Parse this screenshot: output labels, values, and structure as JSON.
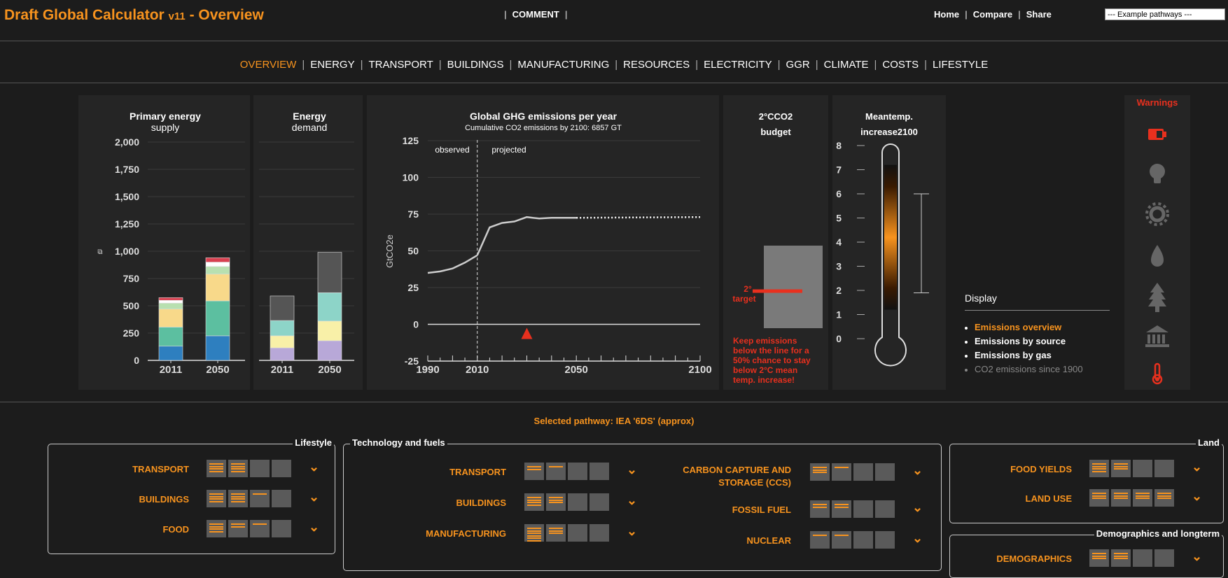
{
  "header": {
    "title": "Draft Global Calculator",
    "version": "v11",
    "title_suffix": "- Overview",
    "comment_label": "COMMENT",
    "links": [
      "Home",
      "Compare",
      "Share"
    ],
    "pathway_select": "--- Example pathways ---"
  },
  "nav": {
    "tabs": [
      "OVERVIEW",
      "ENERGY",
      "TRANSPORT",
      "BUILDINGS",
      "MANUFACTURING",
      "RESOURCES",
      "ELECTRICITY",
      "GGR",
      "CLIMATE",
      "COSTS",
      "LIFESTYLE"
    ],
    "active": "OVERVIEW"
  },
  "colors": {
    "accent": "#f7931e",
    "warning": "#e8301e",
    "background": "#1c1c1c",
    "panel": "#252525"
  },
  "charts": {
    "primary": {
      "title_line1": "Primary energy",
      "title_line2": "supply"
    },
    "demand": {
      "title_line1": "Energy",
      "title_line2": "demand"
    },
    "ghg": {
      "title": "Global GHG emissions per year",
      "subtitle": "Cumulative CO2 emissions by 2100: 6857 GT",
      "ylabel": "GtCO2e",
      "observed": "observed",
      "projected": "projected"
    },
    "budget": {
      "title_line1": "2°CCO2",
      "title_line2": "budget",
      "target_line1": "2°",
      "target_line2": "target",
      "note": [
        "Keep emissions",
        "below the line for a",
        "50% chance to stay",
        "below 2°C mean",
        "temp. increase!"
      ]
    },
    "temp": {
      "title_line1": "Meantemp.",
      "title_line2": "increase2100"
    }
  },
  "chart_data": [
    {
      "type": "bar",
      "title": "Primary energy supply",
      "categories": [
        "2011",
        "2050"
      ],
      "ylim": [
        0,
        2000
      ],
      "yticks": [
        0,
        250,
        500,
        750,
        1000,
        1250,
        1500,
        1750,
        2000
      ],
      "series": [
        {
          "color": "#2e7fbf",
          "values": [
            130,
            225
          ]
        },
        {
          "color": "#5cbfa0",
          "values": [
            175,
            320
          ]
        },
        {
          "color": "#f8d98a",
          "values": [
            165,
            245
          ]
        },
        {
          "color": "#b8e0b0",
          "values": [
            55,
            70
          ]
        },
        {
          "color": "#ffffff",
          "values": [
            25,
            40
          ]
        },
        {
          "color": "#d84050",
          "values": [
            25,
            40
          ]
        }
      ],
      "totals": [
        575,
        970
      ]
    },
    {
      "type": "bar",
      "title": "Energy demand",
      "categories": [
        "2011",
        "2050"
      ],
      "ylim": [
        0,
        2000
      ],
      "series": [
        {
          "color": "#b8a8d8",
          "values": [
            115,
            180
          ]
        },
        {
          "color": "#f8f0a8",
          "values": [
            110,
            180
          ]
        },
        {
          "color": "#8dd4c8",
          "values": [
            140,
            260
          ]
        },
        {
          "color": "#555555",
          "values": [
            225,
            370
          ]
        }
      ],
      "totals": [
        590,
        990
      ]
    },
    {
      "type": "line",
      "title": "Global GHG emissions per year",
      "ylabel": "GtCO2e",
      "ylim": [
        -25,
        125
      ],
      "yticks": [
        -25,
        0,
        25,
        50,
        75,
        100,
        125
      ],
      "xlim": [
        1990,
        2100
      ],
      "xticks": [
        1990,
        2010,
        2050,
        2100
      ],
      "observed": {
        "x": [
          1990,
          1995,
          2000,
          2005,
          2010
        ],
        "y": [
          35,
          36,
          38,
          42,
          47
        ]
      },
      "projected": {
        "x": [
          2010,
          2015,
          2020,
          2025,
          2030,
          2035,
          2040,
          2045,
          2050
        ],
        "y": [
          47,
          66,
          69,
          70,
          73,
          72,
          72.5,
          72.5,
          72.5
        ]
      },
      "dotted": {
        "x": [
          2050,
          2100
        ],
        "y": [
          72.5,
          73
        ]
      },
      "marker_x": 2030
    },
    {
      "type": "bar",
      "title": "2°CCO2 budget"
    },
    {
      "type": "bar",
      "title": "Meantemp. increase2100",
      "ylim": [
        0,
        8
      ],
      "yticks": [
        0,
        1,
        2,
        3,
        4,
        5,
        6,
        7,
        8
      ],
      "range": [
        1.9,
        6
      ]
    }
  ],
  "warnings": {
    "title": "Warnings",
    "icons": [
      "battery-icon",
      "lightbulb-icon",
      "gear-icon",
      "water-drop-icon",
      "tree-icon",
      "bank-icon",
      "thermometer-icon"
    ]
  },
  "display": {
    "title": "Display",
    "options": [
      "Emissions overview",
      "Emissions by source",
      "Emissions by gas",
      "CO2 emissions since 1900"
    ],
    "active": "Emissions overview"
  },
  "selected_pathway": "Selected pathway: IEA '6DS' (approx)",
  "levers": {
    "lifestyle": {
      "label": "Lifestyle",
      "items": [
        {
          "label": "TRANSPORT",
          "levels": [
            4,
            4,
            0,
            0
          ]
        },
        {
          "label": "BUILDINGS",
          "levels": [
            4,
            4,
            1,
            0
          ]
        },
        {
          "label": "FOOD",
          "levels": [
            4,
            2,
            1,
            0
          ]
        }
      ]
    },
    "tech": {
      "label": "Technology and fuels",
      "col1": [
        {
          "label": "TRANSPORT",
          "levels": [
            2,
            1,
            0,
            0
          ]
        },
        {
          "label": "BUILDINGS",
          "levels": [
            4,
            3,
            0,
            0
          ]
        },
        {
          "label": "MANUFACTURING",
          "levels": [
            6,
            3,
            0,
            0
          ]
        }
      ],
      "col2": [
        {
          "label": "CARBON CAPTURE AND",
          "label2": "STORAGE (CCS)",
          "levels": [
            3,
            1,
            0,
            0
          ]
        },
        {
          "label": "FOSSIL FUEL",
          "levels": [
            2,
            2,
            0,
            0
          ]
        },
        {
          "label": "NUCLEAR",
          "levels": [
            1,
            1,
            0,
            0
          ]
        }
      ]
    },
    "land": {
      "label": "Land",
      "items": [
        {
          "label": "FOOD YIELDS",
          "levels": [
            4,
            3,
            0,
            0
          ]
        },
        {
          "label": "LAND USE",
          "levels": [
            3,
            3,
            3,
            3
          ]
        }
      ]
    },
    "demographics": {
      "label": "Demographics and longterm",
      "items": [
        {
          "label": "DEMOGRAPHICS",
          "levels": [
            3,
            3,
            0,
            0
          ]
        }
      ]
    }
  }
}
